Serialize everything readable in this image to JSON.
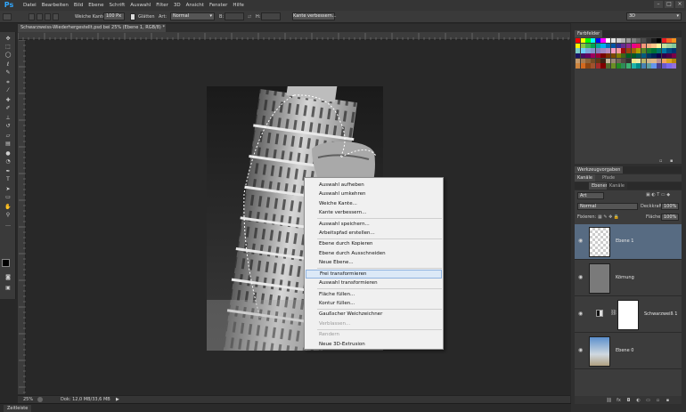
{
  "app": {
    "logo": "Ps",
    "menu": [
      "Datei",
      "Bearbeiten",
      "Bild",
      "Ebene",
      "Schrift",
      "Auswahl",
      "Filter",
      "3D",
      "Ansicht",
      "Fenster",
      "Hilfe"
    ]
  },
  "options_bar": {
    "feather_label": "Weiche Kante:",
    "feather_value": "100 Px",
    "antialias_label": "Glätten",
    "style_label": "Art:",
    "style_value": "Normal",
    "width_label": "B:",
    "height_label": "H:",
    "refine_button": "Kante verbessern...",
    "workspace": "3D"
  },
  "document": {
    "tab_title": "Schwarzweiss-Wiederhergestellt.psd bei 25% (Ebene 1, RGB/8) *",
    "zoom": "25%",
    "doc_info": "Dok: 12,0 MB/33,6 MB"
  },
  "timeline_label": "Zeitleiste",
  "context_menu": {
    "items": [
      {
        "label": "Auswahl aufheben",
        "disabled": false
      },
      {
        "label": "Auswahl umkehren",
        "disabled": false
      },
      {
        "label": "Weiche Kante...",
        "disabled": false
      },
      {
        "label": "Kante verbessern...",
        "disabled": false
      },
      {
        "label": "Auswahl speichern...",
        "disabled": false
      },
      {
        "label": "Arbeitspfad erstellen...",
        "disabled": false
      },
      {
        "label": "Ebene durch Kopieren",
        "disabled": false
      },
      {
        "label": "Ebene durch Ausschneiden",
        "disabled": false
      },
      {
        "label": "Neue Ebene...",
        "disabled": false
      },
      {
        "label": "Frei transformieren",
        "disabled": false,
        "highlighted": true
      },
      {
        "label": "Auswahl transformieren",
        "disabled": false
      },
      {
        "label": "Fläche füllen...",
        "disabled": false
      },
      {
        "label": "Kontur füllen...",
        "disabled": false
      },
      {
        "label": "Gaußscher Weichzeichner",
        "disabled": false
      },
      {
        "label": "Verblassen...",
        "disabled": true
      },
      {
        "label": "Rendern",
        "disabled": true
      },
      {
        "label": "Neue 3D-Extrusion",
        "disabled": false
      }
    ]
  },
  "panels": {
    "swatches_tab": "Farbfelder",
    "properties_tab": "Werkzeugvorgaben",
    "layer_comps_tab": "Kanäle",
    "paths_tab": "Pfade",
    "layers_tab": "Ebenen",
    "channels_tab": "Kanäle",
    "filter_kind": "Art",
    "blend_mode": "Normal",
    "opacity_label": "Deckkraft:",
    "opacity_value": "100%",
    "lock_label": "Fixieren:",
    "fill_label": "Fläche:",
    "fill_value": "100%"
  },
  "layers": [
    {
      "name": "Ebene 1",
      "selected": true
    },
    {
      "name": "Körnung",
      "selected": false
    },
    {
      "name": "Schwarzweiß 1",
      "selected": false
    },
    {
      "name": "Ebene 0",
      "selected": false
    }
  ],
  "colors": {
    "accent": "#31a8ff",
    "selected_layer": "#576b82",
    "menu_highlight": "#dce9f7"
  }
}
